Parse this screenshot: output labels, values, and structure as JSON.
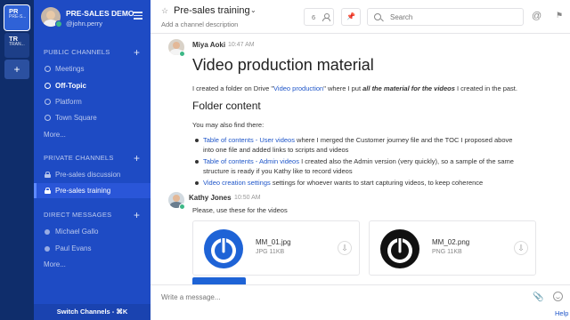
{
  "teams": [
    {
      "abbr": "PR",
      "sub": "PRE-S...",
      "active": true
    },
    {
      "abbr": "TR",
      "sub": "TRAN...",
      "active": false
    }
  ],
  "team_add_label": "+",
  "sidebar": {
    "team_name": "PRE-SALES DEMO",
    "username": "@john.perry",
    "public_header": "PUBLIC CHANNELS",
    "public_channels": [
      "Meetings",
      "Off-Topic",
      "Platform",
      "Town Square"
    ],
    "public_more": "More...",
    "private_header": "PRIVATE CHANNELS",
    "private_channels": [
      "Pre-sales discussion",
      "Pre-sales training"
    ],
    "direct_header": "DIRECT MESSAGES",
    "direct_messages": [
      "Michael Gallo",
      "Paul Evans"
    ],
    "direct_more": "More...",
    "add_label": "+",
    "switch_channels": "Switch Channels - ⌘K"
  },
  "header": {
    "channel_name": "Pre-sales training",
    "description": "Add a channel description",
    "member_count": "6",
    "search_placeholder": "Search"
  },
  "post1": {
    "author": "Miya Aoki",
    "time": "10:47 AM",
    "heading": "Video production material",
    "intro_a": "I created a folder on Drive \"",
    "intro_link": "Video production",
    "intro_b": "\" where I put ",
    "intro_em": "all the material for the videos",
    "intro_c": " I created in the past.",
    "subheading": "Folder content",
    "also_find": "You may also find there:",
    "bullet1_link": "Table of contents - User videos",
    "bullet1_text": " where I merged the Customer journey file and the TOC I proposed above",
    "bullet1_line2": "into one file and added links to scripts and videos",
    "bullet2_link": "Table of contents - Admin videos",
    "bullet2_text": " I created also the Admin version (very quickly), so a sample of the same",
    "bullet2_line2": "structure is ready if you Kathy like to record videos",
    "bullet3_link": "Video creation settings",
    "bullet3_text": " settings for whoever wants to start capturing videos, to keep coherence"
  },
  "post2": {
    "author": "Kathy Jones",
    "time": "10:50 AM",
    "text": "Please, use these for the videos"
  },
  "files": [
    {
      "name": "MM_01.jpg",
      "meta": "JPG 11KB"
    },
    {
      "name": "MM_02.png",
      "meta": "PNG 11KB"
    }
  ],
  "composer": {
    "placeholder": "Write a message...",
    "help": "Help"
  },
  "colors": {
    "team_rail": "#0f2d6b",
    "sidebar": "#1e4bc4",
    "link": "#1f56c9",
    "online": "#3db887",
    "logo_blue": "#1e63d6"
  }
}
